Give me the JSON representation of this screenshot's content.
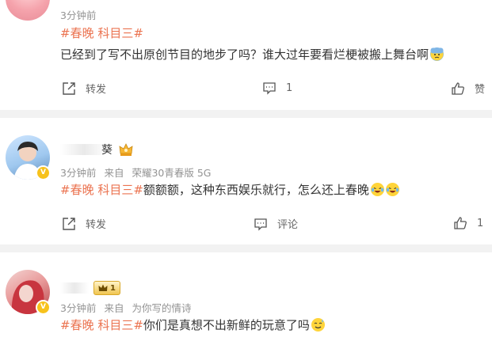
{
  "posts": [
    {
      "username": "",
      "time": "3分钟前",
      "source_prefix": "",
      "source": "",
      "text": "已经到了写不出原创节目的地步了吗？谁大过年要看烂梗被搬上舞台啊",
      "tags_line": "#春晚 科目三#",
      "emoji": "anxious-sweat",
      "actions": {
        "repost": "转发",
        "comment": "1",
        "like": "赞"
      }
    },
    {
      "username": "葵",
      "time": "3分钟前",
      "source_prefix": "来自",
      "source": "荣耀30青春版 5G",
      "tag": "#春晚 科目三#",
      "text": "额额额，这种东西娱乐就行，怎么还上春晚",
      "emoji": [
        "laughing-tears",
        "laughing-tears"
      ],
      "actions": {
        "repost": "转发",
        "comment": "评论",
        "like": "1"
      }
    },
    {
      "username": "",
      "level_badge": "1",
      "time": "3分钟前",
      "source_prefix": "来自",
      "source": "为你写的情诗",
      "tag": "#春晚 科目三#",
      "text": "你们是真想不出新鲜的玩意了吗",
      "emoji": "sweat-smile"
    }
  ],
  "colors": {
    "tag": "#eb7350",
    "meta": "#939393",
    "separator": "#f2f2f2",
    "badge": "#f7c21c"
  }
}
